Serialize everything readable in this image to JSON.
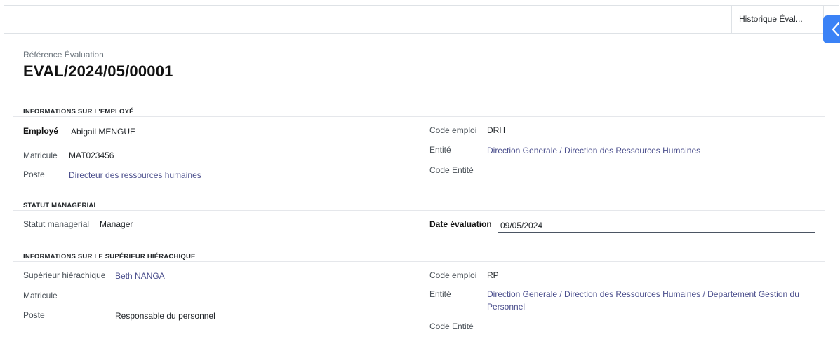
{
  "header": {
    "smart_button_label": "Historique Éval...",
    "side_toggle_icon": "chevron-left-icon",
    "accent_color": "#3b82f6"
  },
  "reference": {
    "label": "Référence Évaluation",
    "value": "EVAL/2024/05/00001"
  },
  "employee_section": {
    "title": "INFORMATIONS SUR L'EMPLOYÉ",
    "employee_label": "Employé",
    "employee_value": "Abigail MENGUE",
    "matricule_label": "Matricule",
    "matricule_value": "MAT023456",
    "poste_label": "Poste",
    "poste_value": "Directeur des ressources humaines",
    "code_emploi_label": "Code emploi",
    "code_emploi_value": "DRH",
    "entite_label": "Entité",
    "entite_value": "Direction Generale / Direction des Ressources Humaines",
    "code_entite_label": "Code Entité"
  },
  "managerial_section": {
    "title": "STATUT MANAGERIAL",
    "statut_label": "Statut managerial",
    "statut_value": "Manager",
    "date_label": "Date évaluation",
    "date_value": "09/05/2024"
  },
  "superior_section": {
    "title": "INFORMATIONS SUR LE SUPÉRIEUR HIÉRACHIQUE",
    "superieur_label": "Supérieur hiérachique",
    "superieur_value": "Beth NANGA",
    "matricule_label": "Matricule",
    "poste_label": "Poste",
    "poste_value": "Responsable du personnel",
    "code_emploi_label": "Code emploi",
    "code_emploi_value": "RP",
    "entite_label": "Entité",
    "entite_value": "Direction Generale / Direction des Ressources Humaines / Departement Gestion du Personnel",
    "code_entite_label": "Code Entité"
  }
}
